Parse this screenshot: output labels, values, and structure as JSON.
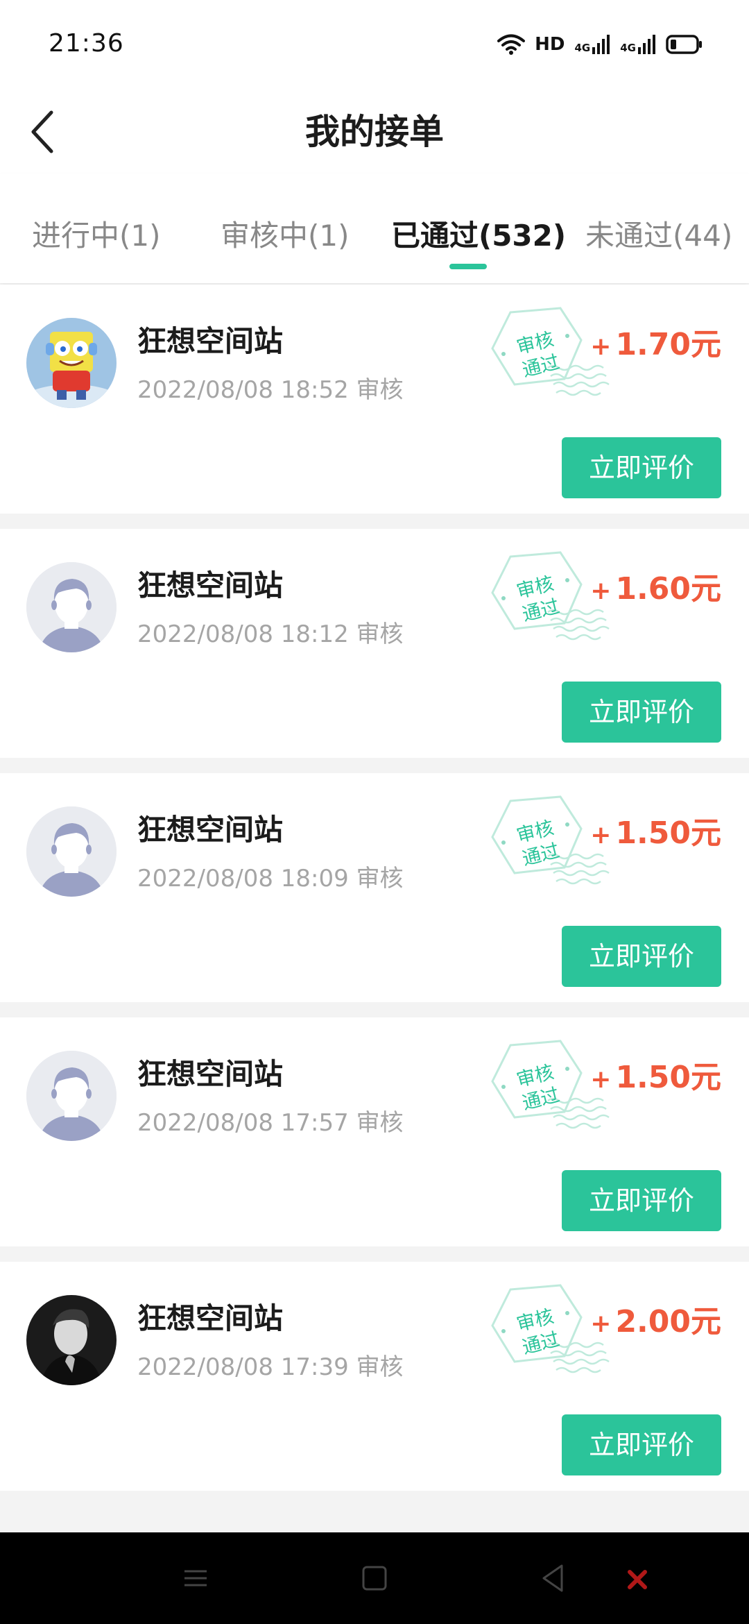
{
  "status_bar": {
    "time": "21:36",
    "network_label": "HD",
    "signal_1": "4G",
    "signal_2": "4G"
  },
  "header": {
    "title": "我的接单"
  },
  "tabs": [
    {
      "label": "进行中(1)",
      "active": false
    },
    {
      "label": "审核中(1)",
      "active": false
    },
    {
      "label": "已通过(532)",
      "active": true
    },
    {
      "label": "未通过(44)",
      "active": false
    }
  ],
  "stamp_text": "审核通过",
  "orders": [
    {
      "name": "狂想空间站",
      "time": "2022/08/08 18:52 审核",
      "amount": "1.70元",
      "button": "立即评价",
      "avatar": "spongebob-avatar"
    },
    {
      "name": "狂想空间站",
      "time": "2022/08/08 18:12 审核",
      "amount": "1.60元",
      "button": "立即评价",
      "avatar": "default-user-avatar"
    },
    {
      "name": "狂想空间站",
      "time": "2022/08/08 18:09 审核",
      "amount": "1.50元",
      "button": "立即评价",
      "avatar": "default-user-avatar"
    },
    {
      "name": "狂想空间站",
      "time": "2022/08/08 17:57 审核",
      "amount": "1.50元",
      "button": "立即评价",
      "avatar": "default-user-avatar"
    },
    {
      "name": "狂想空间站",
      "time": "2022/08/08 17:39 审核",
      "amount": "2.00元",
      "button": "立即评价",
      "avatar": "photo-user-avatar"
    }
  ],
  "amount_prefix": "+",
  "colors": {
    "accent": "#2bc49a",
    "amount": "#ef5a3c",
    "stamp": "#2bc49a"
  },
  "nav_bar": {
    "icons": [
      "menu-icon",
      "home-icon",
      "back-triangle-icon"
    ]
  }
}
